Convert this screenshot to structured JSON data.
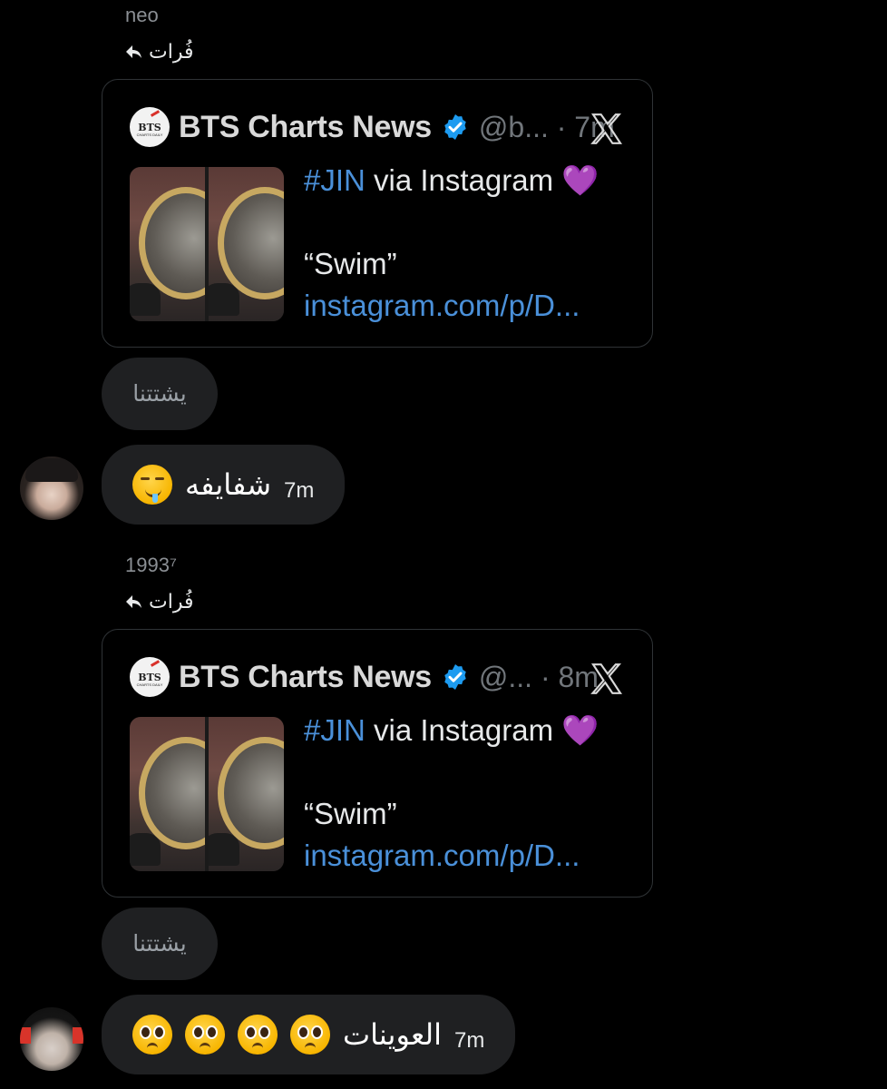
{
  "messages": [
    {
      "sender": "neo",
      "reply_to": "فُرات",
      "tweet": {
        "channel_name": "BTS Charts News",
        "handle_time": "@b... · 7m",
        "hashtag": "#JIN",
        "text_line1": " via Instagram ",
        "heart": "💜",
        "text_line2": "“Swim”",
        "link": "instagram.com/p/D..."
      },
      "reaction": "يشتتنا",
      "message": {
        "text": "شفايفه",
        "time": "7m"
      }
    },
    {
      "sender": "1993⁷",
      "reply_to": "فُرات",
      "tweet": {
        "channel_name": "BTS Charts News",
        "handle_time": "@... · 8m",
        "hashtag": "#JIN",
        "text_line1": " via Instagram ",
        "heart": "💜",
        "text_line2": "“Swim”",
        "link": "instagram.com/p/D..."
      },
      "reaction": "يشتتنا",
      "message": {
        "text": "العوينات",
        "time": "7m"
      }
    }
  ],
  "logo": {
    "text": "BTS",
    "sub": "CHARTS DAILY"
  },
  "colors": {
    "background": "#000000",
    "bubble": "#1f2022",
    "link": "#4a90d9",
    "verified": "#1d9bf0",
    "muted": "#71767b"
  },
  "icons": {
    "reply": "reply-arrow-icon",
    "verified": "verified-badge-icon",
    "x_logo": "x-logo-icon",
    "drool_emoji": "drooling-face-icon",
    "plead_emoji": "pleading-face-icon"
  }
}
